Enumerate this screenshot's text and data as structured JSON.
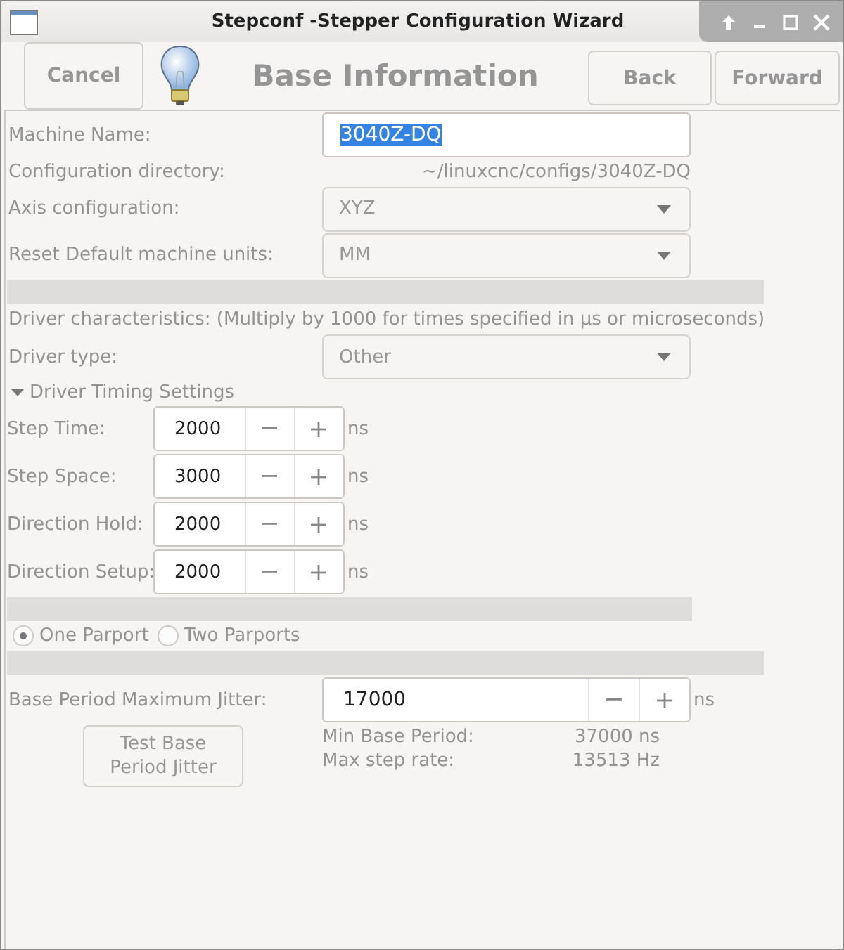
{
  "window": {
    "title": "Stepconf -Stepper Configuration Wizard"
  },
  "header": {
    "title": "Base Information",
    "buttons": [
      {
        "label": "Cancel",
        "disabled": true
      },
      {
        "label": "Back",
        "disabled": true
      },
      {
        "label": "Forward",
        "disabled": true
      }
    ]
  },
  "machine_name": {
    "label": "Machine Name:",
    "value": "3040Z-DQ",
    "text_selected": true
  },
  "config_dir": {
    "label": "Configuration directory:",
    "value": "~/linuxcnc/configs/3040Z-DQ"
  },
  "axis_config": {
    "label": "Axis configuration:",
    "value": "XYZ",
    "disabled": true
  },
  "units": {
    "label": "Reset Default machine units:",
    "value": "MM",
    "disabled": true
  },
  "driver_note": "Driver characteristics: (Multiply by 1000 for times specified in µs or microseconds)",
  "driver_type": {
    "label": "Driver type:",
    "value": "Other",
    "disabled": true
  },
  "timing": {
    "label": "Driver Timing Settings",
    "expanded": true,
    "rows": [
      {
        "label": "Step Time:",
        "value": "2000",
        "unit": "ns"
      },
      {
        "label": "Step Space:",
        "value": "3000",
        "unit": "ns"
      },
      {
        "label": "Direction Hold:",
        "value": "2000",
        "unit": "ns"
      },
      {
        "label": "Direction Setup:",
        "value": "2000",
        "unit": "ns"
      }
    ]
  },
  "parports": [
    {
      "label": "One Parport",
      "selected": true
    },
    {
      "label": "Two Parports",
      "selected": false
    }
  ],
  "jitter": {
    "label": "Base Period Maximum Jitter:",
    "value": "17000",
    "unit": "ns"
  },
  "test_button": {
    "label": "Test Base Period Jitter",
    "disabled": true
  },
  "results": [
    {
      "label": "Min Base Period:",
      "value": "37000 ns"
    },
    {
      "label": "Max step rate:",
      "value": "13513 Hz"
    }
  ]
}
